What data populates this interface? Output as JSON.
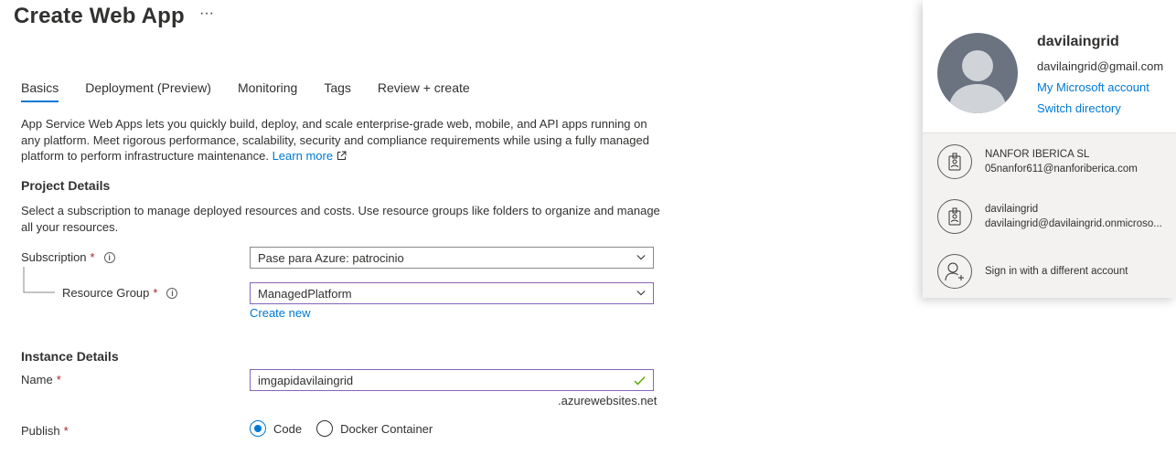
{
  "page": {
    "title": "Create Web App",
    "more": "···"
  },
  "tabs": [
    {
      "label": "Basics"
    },
    {
      "label": "Deployment (Preview)"
    },
    {
      "label": "Monitoring"
    },
    {
      "label": "Tags"
    },
    {
      "label": "Review + create"
    }
  ],
  "intro": {
    "text": "App Service Web Apps lets you quickly build, deploy, and scale enterprise-grade web, mobile, and API apps running on any platform. Meet rigorous performance, scalability, security and compliance requirements while using a fully managed platform to perform infrastructure maintenance.",
    "learn_more": "Learn more"
  },
  "project": {
    "heading": "Project Details",
    "desc": "Select a subscription to manage deployed resources and costs. Use resource groups like folders to organize and manage all your resources.",
    "subscription_label": "Subscription",
    "subscription_value": "Pase para Azure: patrocinio",
    "rg_label": "Resource Group",
    "rg_value": "ManagedPlatform",
    "create_new": "Create new"
  },
  "instance": {
    "heading": "Instance Details",
    "name_label": "Name",
    "name_value": "imgapidavilaingrid",
    "suffix": ".azurewebsites.net",
    "publish_label": "Publish",
    "publish_options": [
      "Code",
      "Docker Container"
    ],
    "publish_selected": "Code"
  },
  "required_mark": "*",
  "info_glyph": "i",
  "account_panel": {
    "name": "davilaingrid",
    "email": "davilaingrid@gmail.com",
    "my_account": "My Microsoft account",
    "switch_directory": "Switch directory",
    "accounts": [
      {
        "org": "NANFOR IBERICA SL",
        "email": "05nanfor611@nanforiberica.com"
      },
      {
        "org": "davilaingrid",
        "email": "davilaingrid@davilaingrid.onmicroso..."
      }
    ],
    "sign_in_other": "Sign in with a different account"
  },
  "colors": {
    "accent": "#0078d4",
    "required": "#a4262c",
    "valid": "#57a300",
    "focus_border": "#8764b8"
  }
}
